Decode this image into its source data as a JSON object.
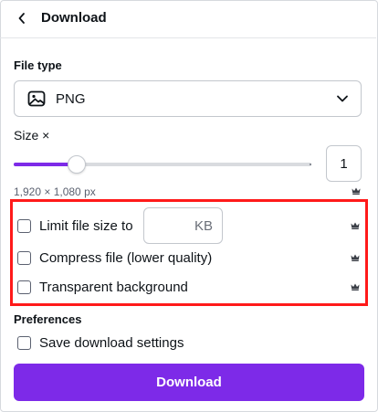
{
  "header": {
    "title": "Download"
  },
  "file_type": {
    "label": "File type",
    "selected": "PNG"
  },
  "size": {
    "label": "Size ×",
    "value": "1",
    "slider_fraction": 0.21,
    "dimensions": "1,920 × 1,080 px"
  },
  "options": {
    "limit_size_label": "Limit file size to",
    "kb_unit": "KB",
    "compress_label": "Compress file (lower quality)",
    "transparent_label": "Transparent background"
  },
  "preferences": {
    "label": "Preferences",
    "save_settings_label": "Save download settings"
  },
  "download_button": {
    "label": "Download"
  },
  "colors": {
    "accent": "#7d2ae8",
    "highlight": "#ff1a1a"
  }
}
